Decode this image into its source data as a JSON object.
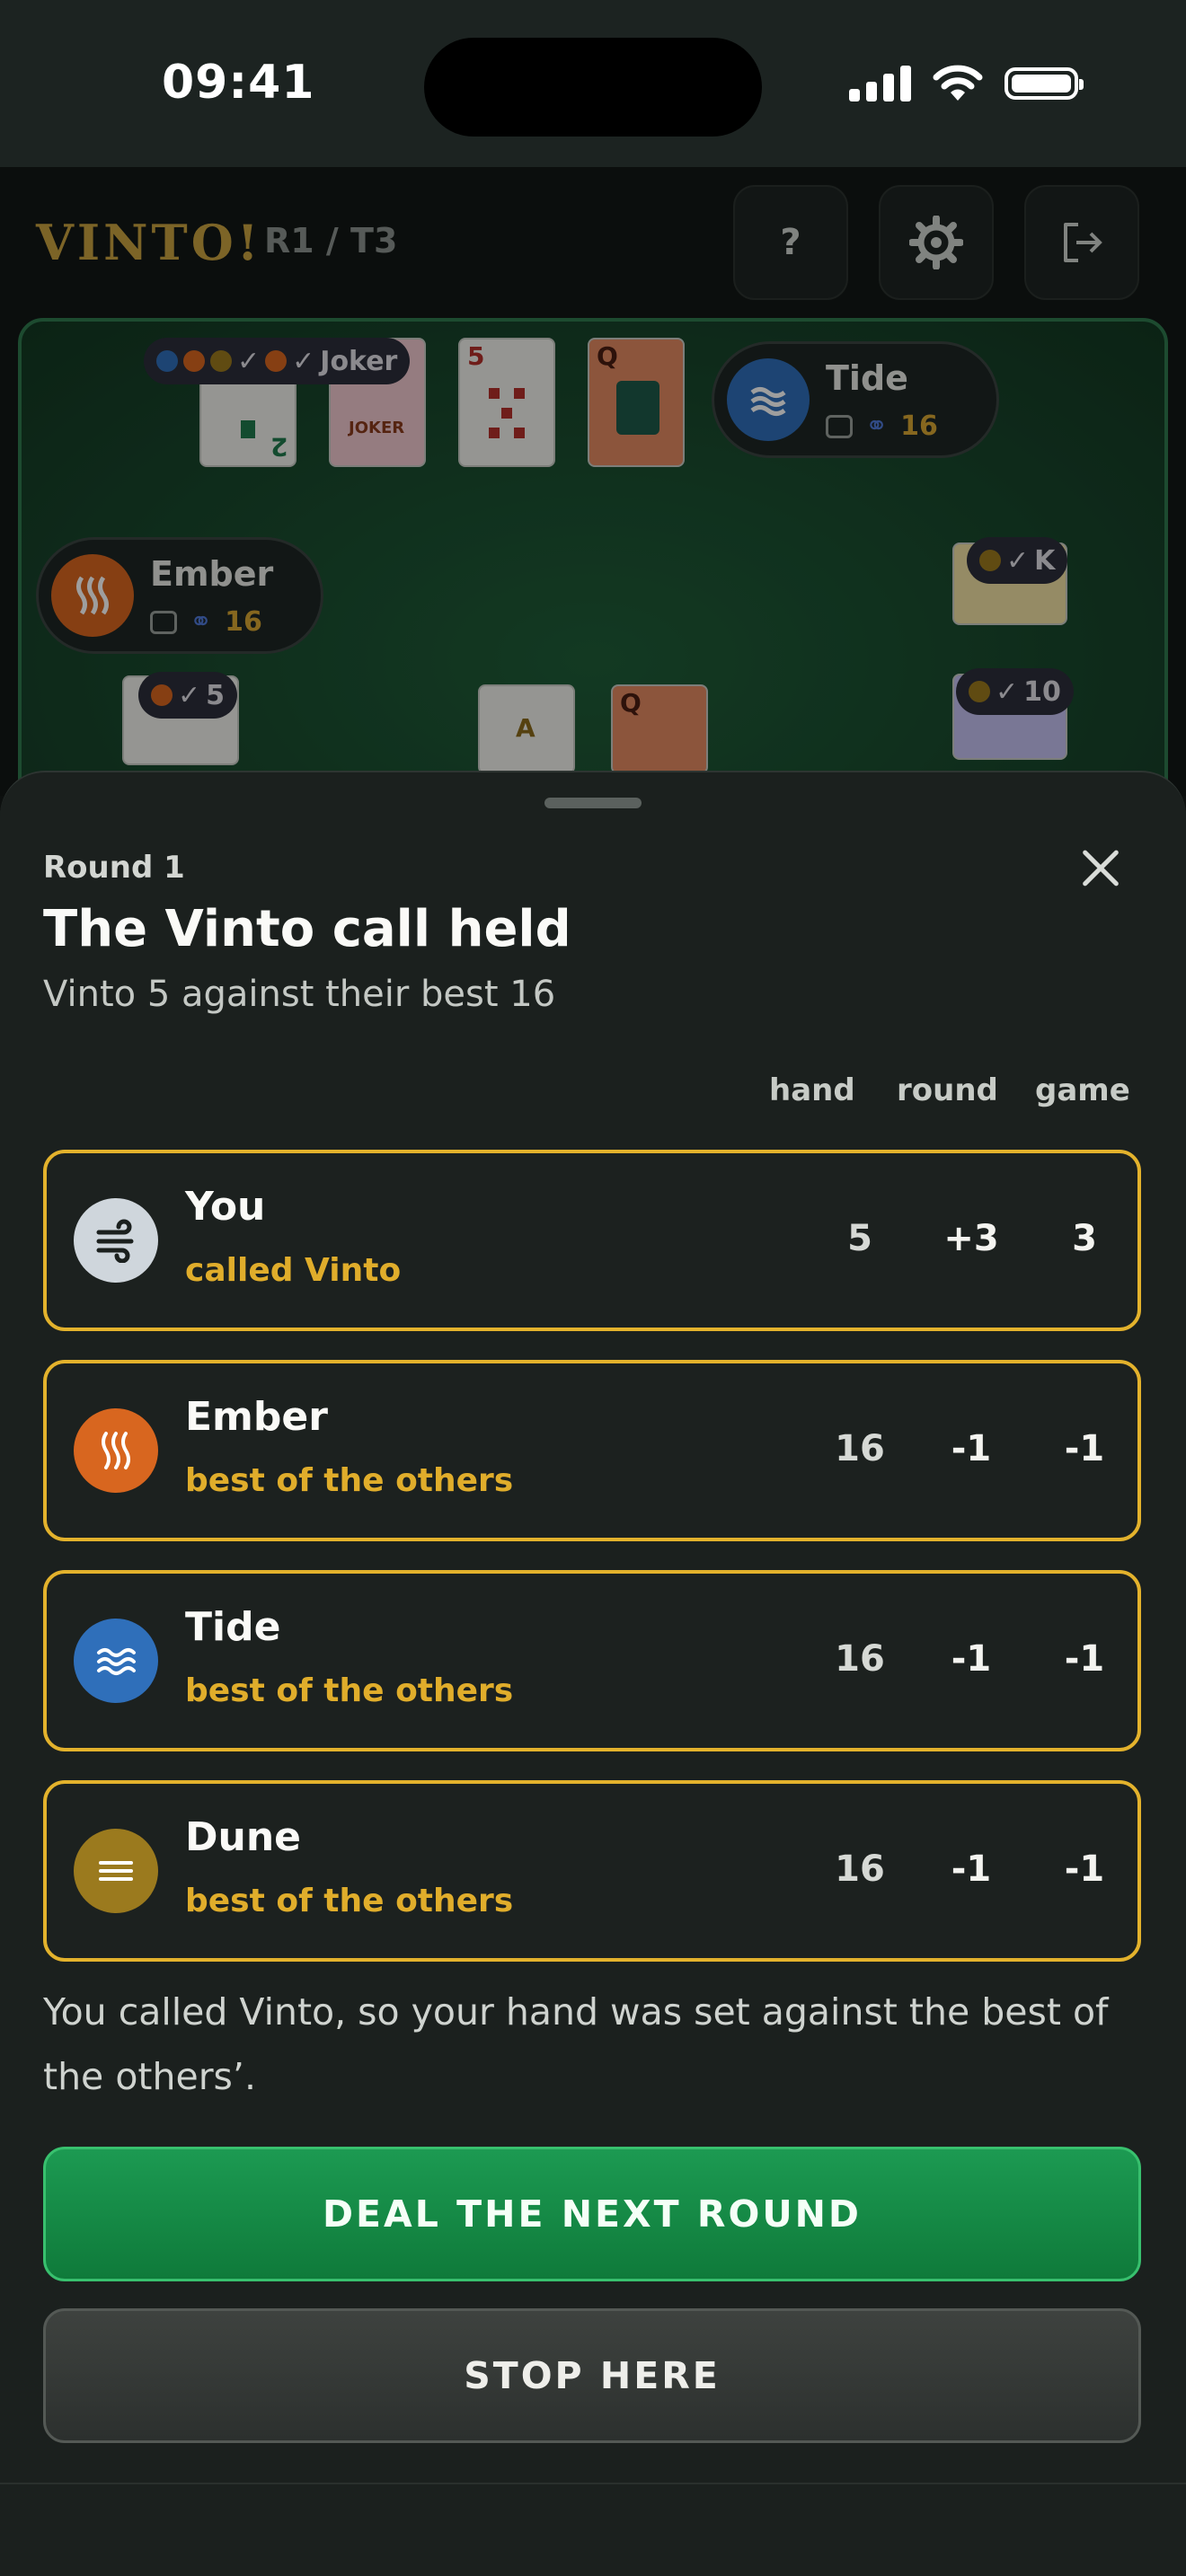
{
  "status_bar": {
    "time": "09:41"
  },
  "header": {
    "brand": "VINTO!",
    "round_turn": "R1 / T3",
    "help_label": "?",
    "settings_icon": "gear-icon",
    "exit_icon": "exit-icon"
  },
  "table": {
    "top_chip_label": "Joker",
    "cards": {
      "top": [
        "2",
        "JOKER",
        "5",
        "Q"
      ],
      "left": [
        "5"
      ],
      "center": [
        "A",
        "Q"
      ],
      "right": [
        "K",
        "10"
      ]
    },
    "chips": {
      "left_low": "5",
      "right_k": "K",
      "right_10": "10"
    },
    "opponents": [
      {
        "name": "Tide",
        "score": "16",
        "color": "#2f6fba"
      },
      {
        "name": "Ember",
        "score": "16",
        "color": "#d8661f"
      }
    ]
  },
  "sheet": {
    "round_label": "Round 1",
    "title": "The Vinto call held",
    "subtitle": "Vinto 5 against their best 16",
    "columns": {
      "hand": "hand",
      "round": "round",
      "game": "game"
    },
    "rows": [
      {
        "name": "You",
        "role": "called Vinto",
        "hand": "5",
        "round": "+3",
        "game": "3",
        "avatar_color": "#cfd6dc",
        "icon": "wind-icon"
      },
      {
        "name": "Ember",
        "role": "best of the others",
        "hand": "16",
        "round": "-1",
        "game": "-1",
        "avatar_color": "#d8661f",
        "icon": "heat-icon"
      },
      {
        "name": "Tide",
        "role": "best of the others",
        "hand": "16",
        "round": "-1",
        "game": "-1",
        "avatar_color": "#2f6fba",
        "icon": "waves-icon"
      },
      {
        "name": "Dune",
        "role": "best of the others",
        "hand": "16",
        "round": "-1",
        "game": "-1",
        "avatar_color": "#9b7a1e",
        "icon": "sand-icon"
      }
    ],
    "explanation": "You called Vinto, so your hand was set against the best of the others’.",
    "primary_button": "DEAL THE NEXT ROUND",
    "secondary_button": "STOP HERE"
  },
  "colors": {
    "accent": "#e3b22c",
    "primary": "#1c9a52"
  }
}
